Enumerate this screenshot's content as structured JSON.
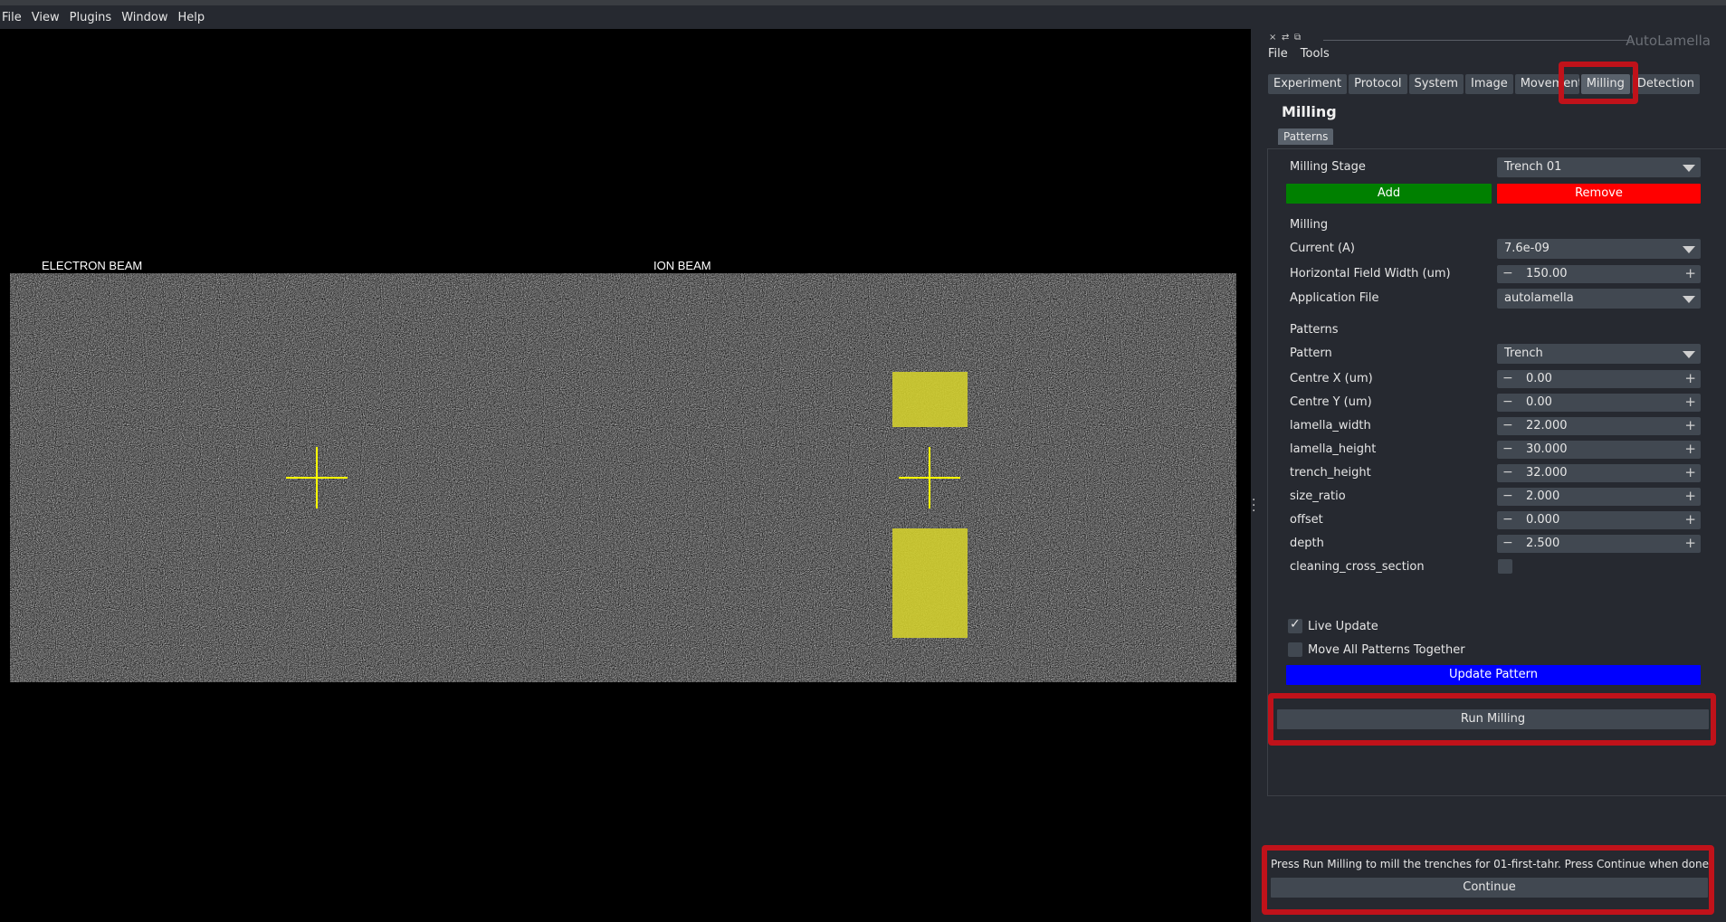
{
  "menubar": {
    "items": [
      "File",
      "View",
      "Plugins",
      "Window",
      "Help"
    ]
  },
  "viewer": {
    "electron_label": "ELECTRON BEAM",
    "ion_label": "ION BEAM"
  },
  "dock": {
    "controls": [
      "×",
      "⇄",
      "⧉"
    ],
    "app_name": "AutoLamella",
    "menu": [
      "File",
      "Tools"
    ],
    "tabs": [
      "Experiment",
      "Protocol",
      "System",
      "Image",
      "Movement",
      "Milling",
      "Detection"
    ],
    "active_tab": "Milling"
  },
  "milling": {
    "title": "Milling",
    "subtab": "Patterns",
    "stage_label": "Milling Stage",
    "stage_value": "Trench 01",
    "add_label": "Add",
    "remove_label": "Remove",
    "milling_section": "Milling",
    "current_label": "Current (A)",
    "current_value": "7.6e-09",
    "hfw_label": "Horizontal Field Width (um)",
    "hfw_value": "150.00",
    "app_file_label": "Application File",
    "app_file_value": "autolamella",
    "patterns_section": "Patterns",
    "pattern_label": "Pattern",
    "pattern_value": "Trench",
    "params": [
      {
        "label": "Centre X (um)",
        "value": "0.00"
      },
      {
        "label": "Centre Y (um)",
        "value": "0.00"
      },
      {
        "label": "lamella_width",
        "value": "22.000"
      },
      {
        "label": "lamella_height",
        "value": "30.000"
      },
      {
        "label": "trench_height",
        "value": "32.000"
      },
      {
        "label": "size_ratio",
        "value": "2.000"
      },
      {
        "label": "offset",
        "value": "0.000"
      },
      {
        "label": "depth",
        "value": "2.500"
      }
    ],
    "cleaning_label": "cleaning_cross_section",
    "live_update_label": "Live Update",
    "live_update_checked": true,
    "move_all_label": "Move All Patterns Together",
    "move_all_checked": false,
    "update_pattern_label": "Update Pattern",
    "run_milling_label": "Run Milling",
    "instruction": "Press Run Milling to mill the trenches for 01-first-tahr. Press Continue when done.",
    "continue_label": "Continue"
  },
  "colors": {
    "add_button": "#008000",
    "remove_button": "#ff0000",
    "update_button": "#0000ff",
    "highlight": "#c0121a",
    "pattern_fill": "#d4d02c",
    "crosshair": "#ffff00"
  }
}
